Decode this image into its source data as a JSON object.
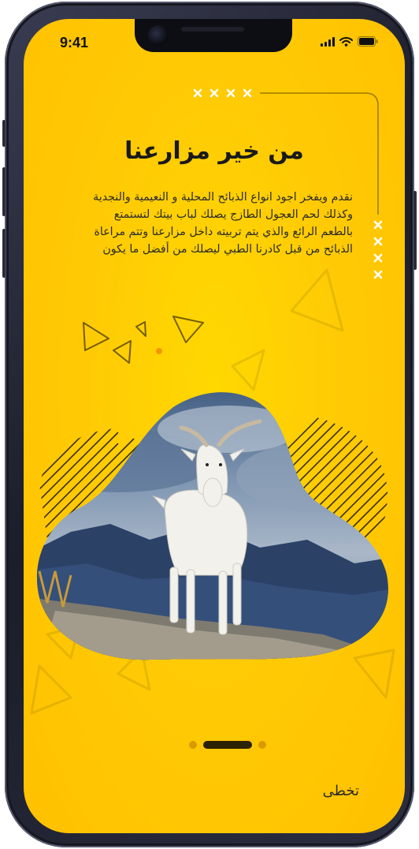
{
  "status_bar": {
    "time": "9:41",
    "signal_icon": "signal-bars-icon",
    "wifi_icon": "wifi-icon",
    "battery_icon": "battery-icon"
  },
  "onboarding": {
    "title": "من خير مزارعنا",
    "description": "نقدم ويفخر اجود انواع الذبائح المحلية و النعيمية والنجدية\nوكذلك لحم العجول الطازج يصلك لباب بيتك لتستمتع\nبالطعم الرائع والذي يتم تربيته داخل مزارعنا وتتم مراعاة\nالذبائح من قبل كادرنا الطبي ليصلك من أفضل ما يكون",
    "image_subject": "white goat on mountain rock",
    "page_count": 3,
    "active_page": 2
  },
  "actions": {
    "skip_label": "تخطى"
  },
  "colors": {
    "background": "#ffc800",
    "accent_dark": "#2b2300",
    "dot_inactive": "#d99a00",
    "decor_lines": "#3a2e00"
  }
}
